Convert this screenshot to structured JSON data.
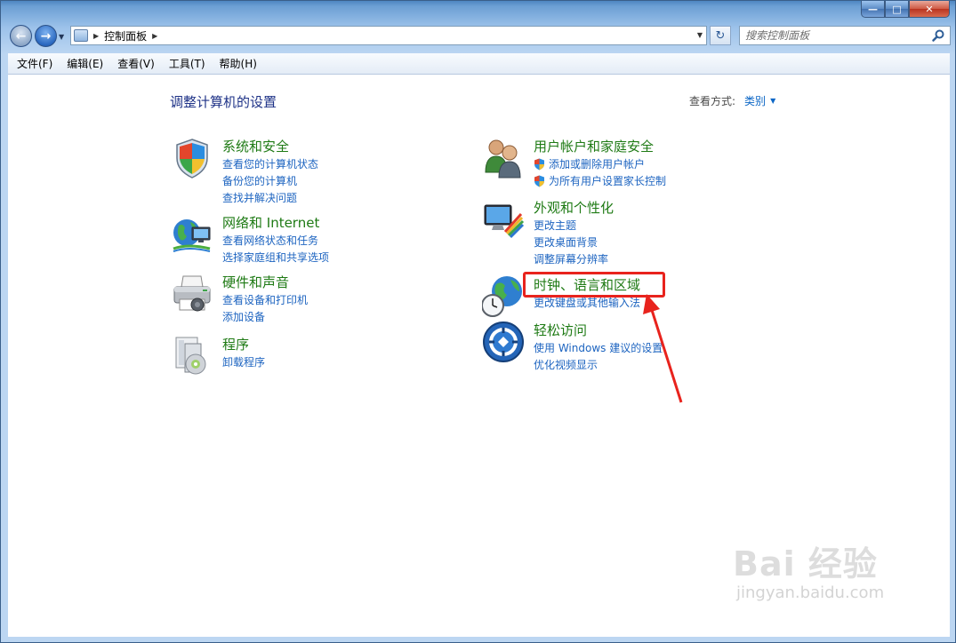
{
  "window": {
    "caption_buttons": {
      "minimize": "—",
      "maximize": "□",
      "close": "✕"
    }
  },
  "address_bar": {
    "location": "控制面板",
    "search_placeholder": "搜索控制面板"
  },
  "menu": [
    "文件(F)",
    "编辑(E)",
    "查看(V)",
    "工具(T)",
    "帮助(H)"
  ],
  "main": {
    "heading": "调整计算机的设置",
    "view_by_label": "查看方式:",
    "view_by_value": "类别"
  },
  "categories": [
    {
      "title": "系统和安全",
      "icon": "shield-icon",
      "links": [
        "查看您的计算机状态",
        "备份您的计算机",
        "查找并解决问题"
      ]
    },
    {
      "title": "网络和 Internet",
      "icon": "network-globe-icon",
      "links": [
        "查看网络状态和任务",
        "选择家庭组和共享选项"
      ]
    },
    {
      "title": "硬件和声音",
      "icon": "printer-icon",
      "links": [
        "查看设备和打印机",
        "添加设备"
      ]
    },
    {
      "title": "程序",
      "icon": "programs-icon",
      "links": [
        "卸载程序"
      ]
    },
    {
      "title": "用户帐户和家庭安全",
      "icon": "users-icon",
      "links": [
        "添加或删除用户帐户",
        "为所有用户设置家长控制"
      ]
    },
    {
      "title": "外观和个性化",
      "icon": "display-palette-icon",
      "links": [
        "更改主题",
        "更改桌面背景",
        "调整屏幕分辨率"
      ]
    },
    {
      "title": "时钟、语言和区域",
      "icon": "globe-clock-icon",
      "links": [
        "更改键盘或其他输入法"
      ]
    },
    {
      "title": "轻松访问",
      "icon": "ease-of-access-icon",
      "links": [
        "使用 Windows 建议的设置",
        "优化视频显示"
      ]
    }
  ],
  "watermark": {
    "top": "Bai 经验",
    "bottom": "jingyan.baidu.com"
  },
  "colors": {
    "category_title": "#1e7a14",
    "link": "#1d64c0",
    "heading": "#1e3287",
    "annotation_red": "#e8231d"
  }
}
